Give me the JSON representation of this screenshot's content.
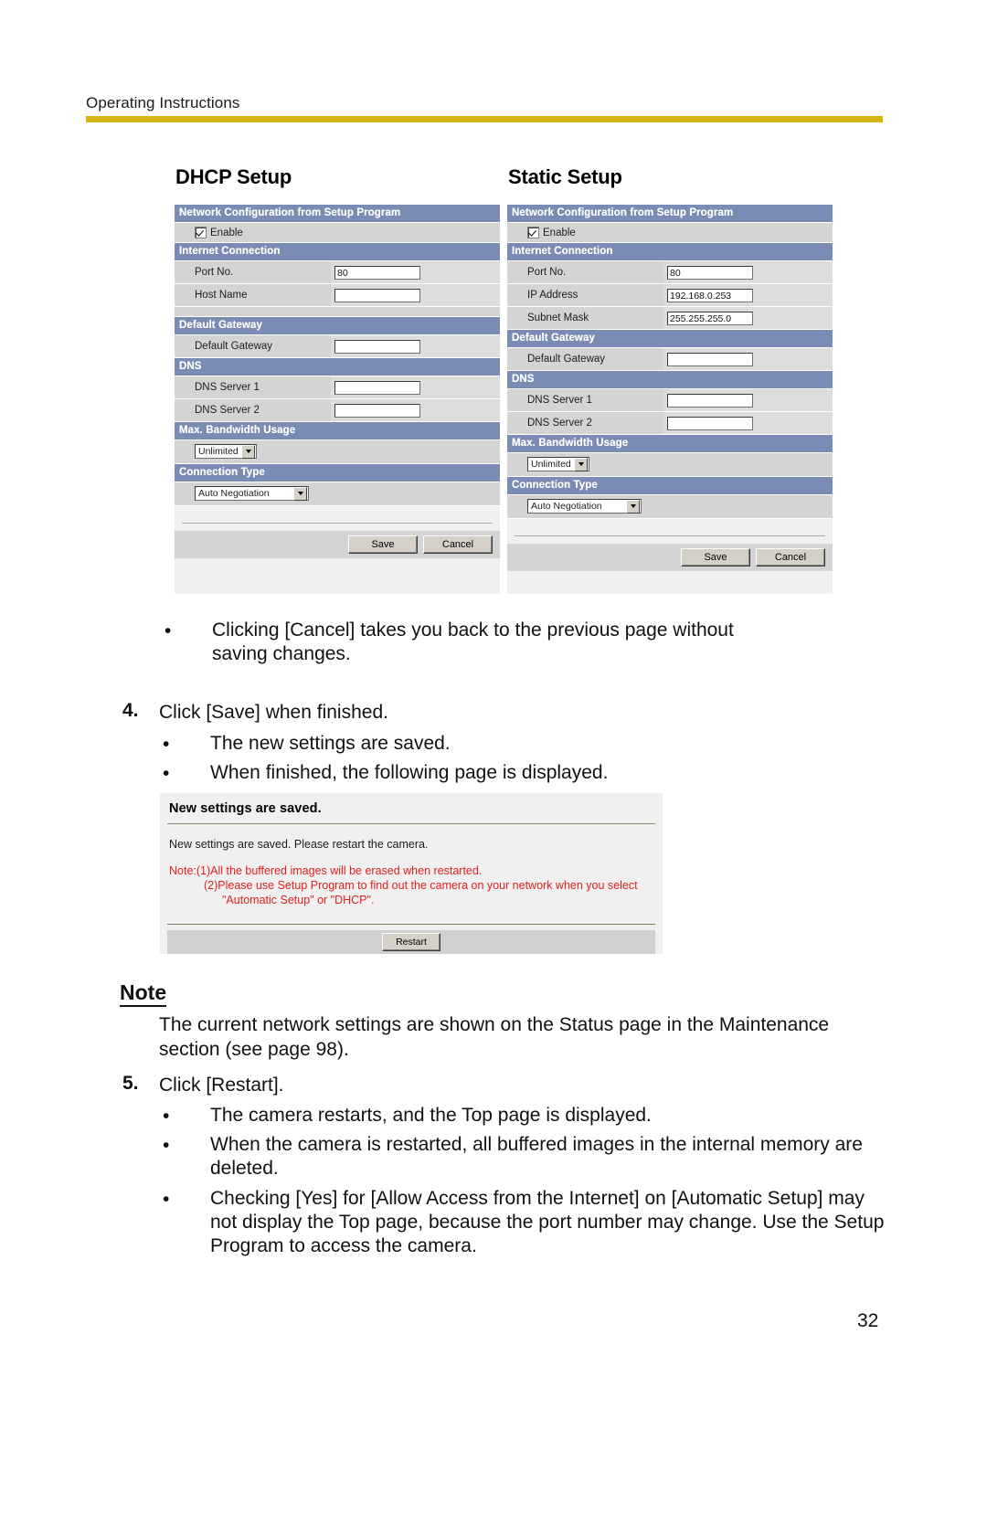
{
  "header": {
    "running_title": "Operating Instructions",
    "rule_color": "#d8b411"
  },
  "screenshots": {
    "dhcp": {
      "title": "DHCP Setup",
      "sections": {
        "network_config": "Network Configuration from Setup Program",
        "internet_connection": "Internet Connection",
        "default_gateway": "Default Gateway",
        "dns": "DNS",
        "max_bandwidth": "Max. Bandwidth Usage",
        "connection_type": "Connection Type"
      },
      "enable_label": "Enable",
      "fields": {
        "port_no_label": "Port No.",
        "port_no_value": "80",
        "host_name_label": "Host Name",
        "host_name_value": "",
        "default_gateway_label": "Default Gateway",
        "default_gateway_value": "",
        "dns1_label": "DNS Server 1",
        "dns1_value": "",
        "dns2_label": "DNS Server 2",
        "dns2_value": ""
      },
      "selects": {
        "bandwidth_value": "Unlimited",
        "connection_type_value": "Auto Negotiation"
      },
      "buttons": {
        "save": "Save",
        "cancel": "Cancel"
      }
    },
    "static": {
      "title": "Static Setup",
      "sections": {
        "network_config": "Network Configuration from Setup Program",
        "internet_connection": "Internet Connection",
        "default_gateway": "Default Gateway",
        "dns": "DNS",
        "max_bandwidth": "Max. Bandwidth Usage",
        "connection_type": "Connection Type"
      },
      "enable_label": "Enable",
      "fields": {
        "port_no_label": "Port No.",
        "port_no_value": "80",
        "ip_address_label": "IP Address",
        "ip_address_value": "192.168.0.253",
        "subnet_mask_label": "Subnet Mask",
        "subnet_mask_value": "255.255.255.0",
        "default_gateway_label": "Default Gateway",
        "default_gateway_value": "",
        "dns1_label": "DNS Server 1",
        "dns1_value": "",
        "dns2_label": "DNS Server 2",
        "dns2_value": ""
      },
      "selects": {
        "bandwidth_value": "Unlimited",
        "connection_type_value": "Auto Negotiation"
      },
      "buttons": {
        "save": "Save",
        "cancel": "Cancel"
      }
    },
    "saved_page": {
      "title": "New settings are saved.",
      "body": "New settings are saved. Please restart the camera.",
      "note_line1": "Note:(1)All the buffered images will be erased when restarted.",
      "note_line2": "(2)Please use Setup Program to find out the camera on your network when you select",
      "note_line3": "\"Automatic Setup\" or \"DHCP\".",
      "restart_button": "Restart",
      "note_color": "#e02020"
    }
  },
  "body": {
    "bullet_cancel": "Clicking [Cancel] takes you back to the previous page without saving changes.",
    "step4_number": "4.",
    "step4_text": "Click [Save] when finished.",
    "step4_bullet1": "The new settings are saved.",
    "step4_bullet2": "When finished, the following page is displayed.",
    "note_heading": "Note",
    "note_text": "The current network settings are shown on the Status page in the Maintenance section (see page 98).",
    "step5_number": "5.",
    "step5_text": "Click [Restart].",
    "step5_bullet1": "The camera restarts, and the Top page is displayed.",
    "step5_bullet2": "When the camera is restarted, all buffered images in the internal memory are deleted.",
    "step5_bullet3": "Checking [Yes] for [Allow Access from the Internet] on [Automatic Setup] may not display the Top page, because the port number may change. Use the Setup Program to access the camera.",
    "bullet_glyph": "•"
  },
  "footer": {
    "page_number": "32"
  }
}
